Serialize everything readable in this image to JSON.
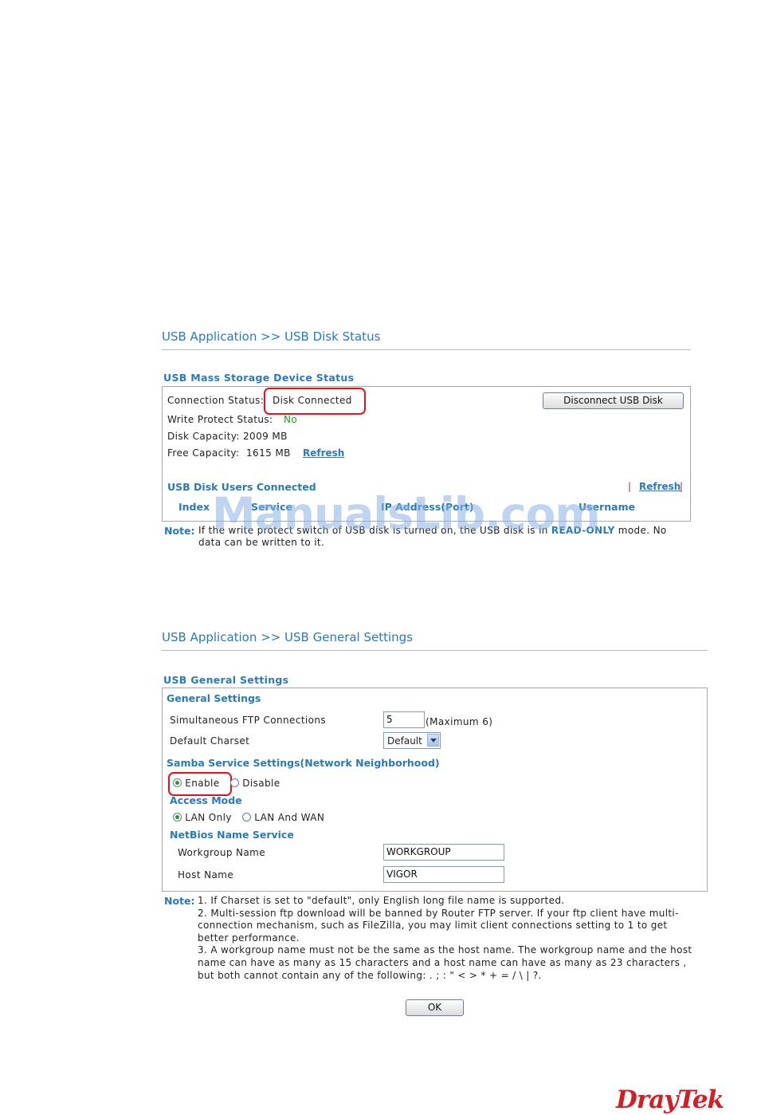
{
  "status_page": {
    "breadcrumb": "USB Application >> USB Disk Status",
    "section_title": "USB Mass Storage Device Status",
    "connection_status_label": "Connection Status:",
    "connection_status_value": "Disk Connected",
    "disconnect_button": "Disconnect USB Disk",
    "write_protect_label": "Write Protect Status:",
    "write_protect_value": "No",
    "disk_capacity_label": "Disk Capacity:",
    "disk_capacity_value": "2009 MB",
    "free_capacity_label": "Free Capacity:",
    "free_capacity_value": "1615 MB",
    "refresh_link": "Refresh",
    "users_title": "USB Disk Users Connected",
    "users_refresh_link": "Refresh",
    "users_columns": [
      "Index",
      "Service",
      "IP Address(Port)",
      "Username"
    ],
    "note_label": "Note:",
    "note_line1_pre": "If the write protect switch of USB disk is turned on, the USB disk is in ",
    "note_line1_highlight": "READ-ONLY",
    "note_line1_post": " mode. No",
    "note_line2": "data can be written to it."
  },
  "settings_page": {
    "breadcrumb": "USB Application >> USB General Settings",
    "section_title": "USB General Settings",
    "general_settings_title": "General Settings",
    "ftp_connections_label": "Simultaneous FTP Connections",
    "ftp_connections_value": "5",
    "ftp_connections_hint": "(Maximum 6)",
    "charset_label": "Default Charset",
    "charset_value": "Default",
    "samba_title": "Samba Service Settings(Network Neighborhood)",
    "samba_enable": "Enable",
    "samba_disable": "Disable",
    "access_mode_title": "Access Mode",
    "access_lan_only": "LAN Only",
    "access_lan_wan": "LAN And WAN",
    "netbios_title": "NetBios Name Service",
    "workgroup_label": "Workgroup Name",
    "workgroup_value": "WORKGROUP",
    "host_label": "Host Name",
    "host_value": "VIGOR",
    "note_label": "Note:",
    "note_lines": [
      "1. If Charset is set to \"default\", only English long file name is supported.",
      "2. Multi-session ftp download will be banned by Router FTP server. If your ftp client have multi-",
      "connection mechanism, such as FileZilla, you may limit client connections setting to 1 to get",
      "better performance.",
      "3. A workgroup name must not be the same as the host name. The workgroup name and the host",
      "name can have as many as 15 characters and a host name can have as many as 23 characters ,",
      "but both cannot contain any of the following: . ; : \" < > * + = / \\ | ?."
    ],
    "ok_button": "OK"
  },
  "watermark": "ManualsLib.com",
  "brand_logo": "DrayTek",
  "colors": {
    "accent": "#2a7ab8",
    "highlight_box": "#e1121b",
    "status_green": "#16a516",
    "logo_red": "#d41e26"
  }
}
